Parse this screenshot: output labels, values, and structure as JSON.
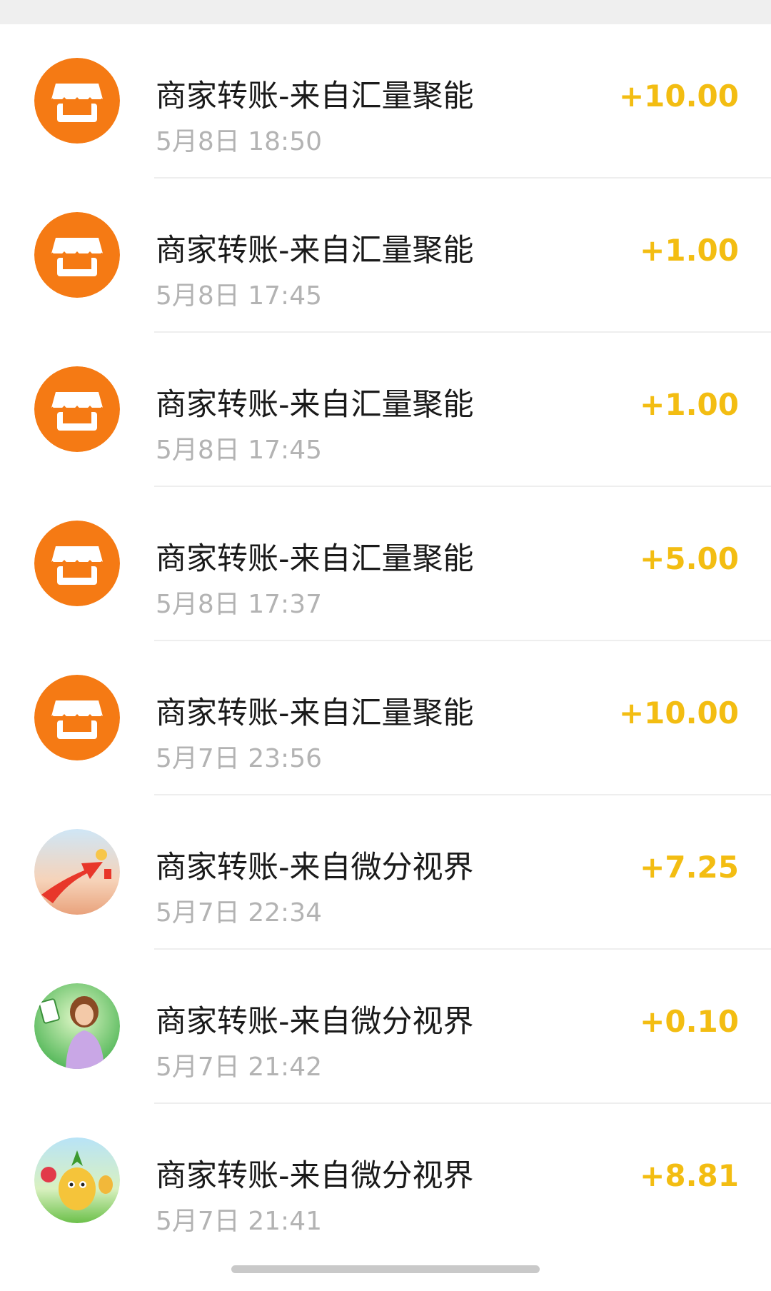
{
  "transactions": [
    {
      "title": "商家转账-来自汇量聚能",
      "time": "5月8日 18:50",
      "amount": "+10.00",
      "avatar": "store-icon"
    },
    {
      "title": "商家转账-来自汇量聚能",
      "time": "5月8日 17:45",
      "amount": "+1.00",
      "avatar": "store-icon"
    },
    {
      "title": "商家转账-来自汇量聚能",
      "time": "5月8日 17:45",
      "amount": "+1.00",
      "avatar": "store-icon"
    },
    {
      "title": "商家转账-来自汇量聚能",
      "time": "5月8日 17:37",
      "amount": "+5.00",
      "avatar": "store-icon"
    },
    {
      "title": "商家转账-来自汇量聚能",
      "time": "5月7日 23:56",
      "amount": "+10.00",
      "avatar": "store-icon"
    },
    {
      "title": "商家转账-来自微分视界",
      "time": "5月7日 22:34",
      "amount": "+7.25",
      "avatar": "red-arrow-game-avatar"
    },
    {
      "title": "商家转账-来自微分视界",
      "time": "5月7日 21:42",
      "amount": "+0.10",
      "avatar": "mahjong-lady-game-avatar"
    },
    {
      "title": "商家转账-来自微分视界",
      "time": "5月7日 21:41",
      "amount": "+8.81",
      "avatar": "pineapple-fruit-game-avatar"
    }
  ],
  "colors": {
    "amount": "#f3bd12",
    "store_avatar_bg": "#f57a14",
    "title": "#1a1a1a",
    "time": "#b3b3b3"
  }
}
